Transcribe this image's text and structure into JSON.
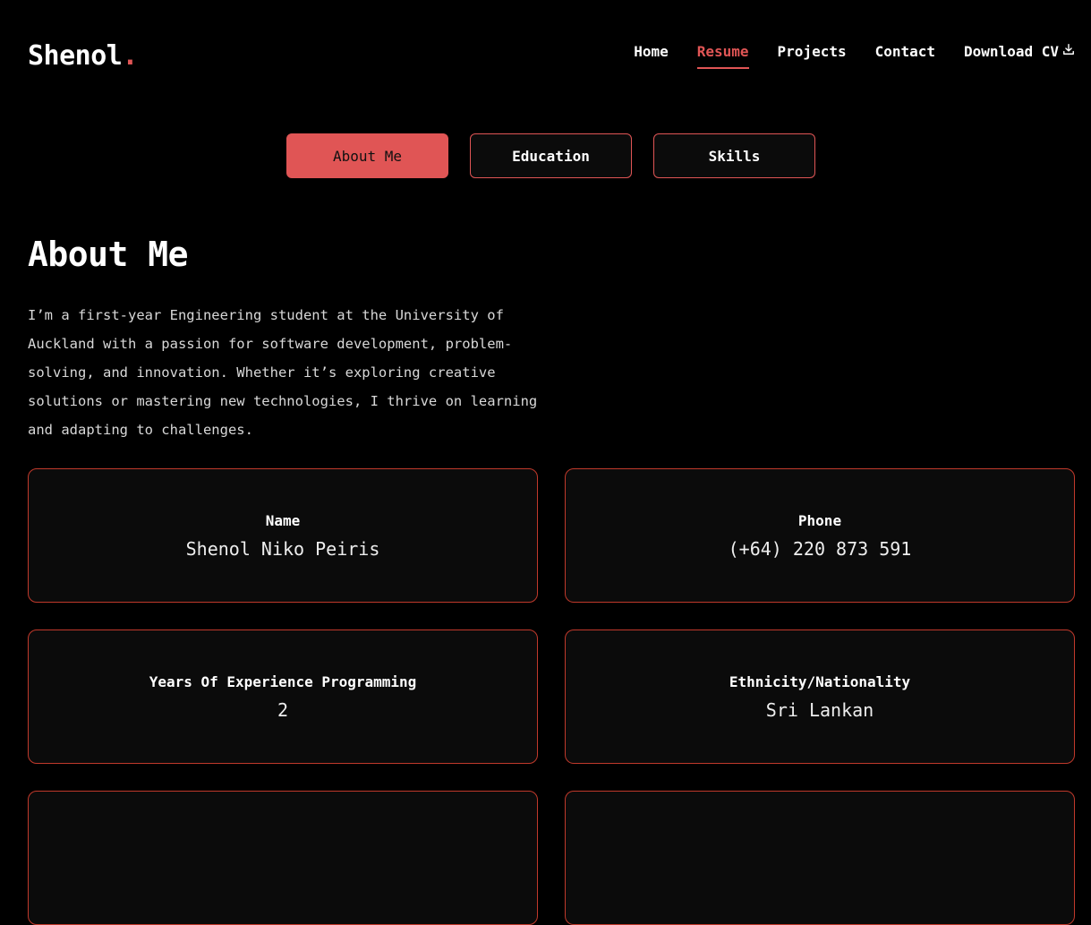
{
  "header": {
    "logo_text": "Shenol",
    "logo_dot": ".",
    "nav": [
      {
        "label": "Home",
        "active": false
      },
      {
        "label": "Resume",
        "active": true
      },
      {
        "label": "Projects",
        "active": false
      },
      {
        "label": "Contact",
        "active": false
      }
    ],
    "download_label": "Download CV",
    "download_icon": "download-icon"
  },
  "tabs": [
    {
      "label": "About Me",
      "active": true
    },
    {
      "label": "Education",
      "active": false
    },
    {
      "label": "Skills",
      "active": false
    }
  ],
  "about": {
    "title": "About Me",
    "intro": "I’m a first-year Engineering student at the University of Auckland with a passion for software development, problem-solving, and innovation. Whether it’s exploring creative solutions or mastering new technologies, I thrive on learning and adapting to challenges."
  },
  "info_cards": [
    {
      "label": "Name",
      "value": "Shenol Niko Peiris"
    },
    {
      "label": "Phone",
      "value": "(+64) 220 873 591"
    },
    {
      "label": "Years Of Experience Programming",
      "value": "2"
    },
    {
      "label": "Ethnicity/Nationality",
      "value": "Sri Lankan"
    },
    {
      "label": "",
      "value": ""
    },
    {
      "label": "",
      "value": ""
    }
  ],
  "colors": {
    "accent": "#e05555",
    "background": "#000000",
    "card_background": "#0b0b0b",
    "card_border": "#c0392b"
  }
}
